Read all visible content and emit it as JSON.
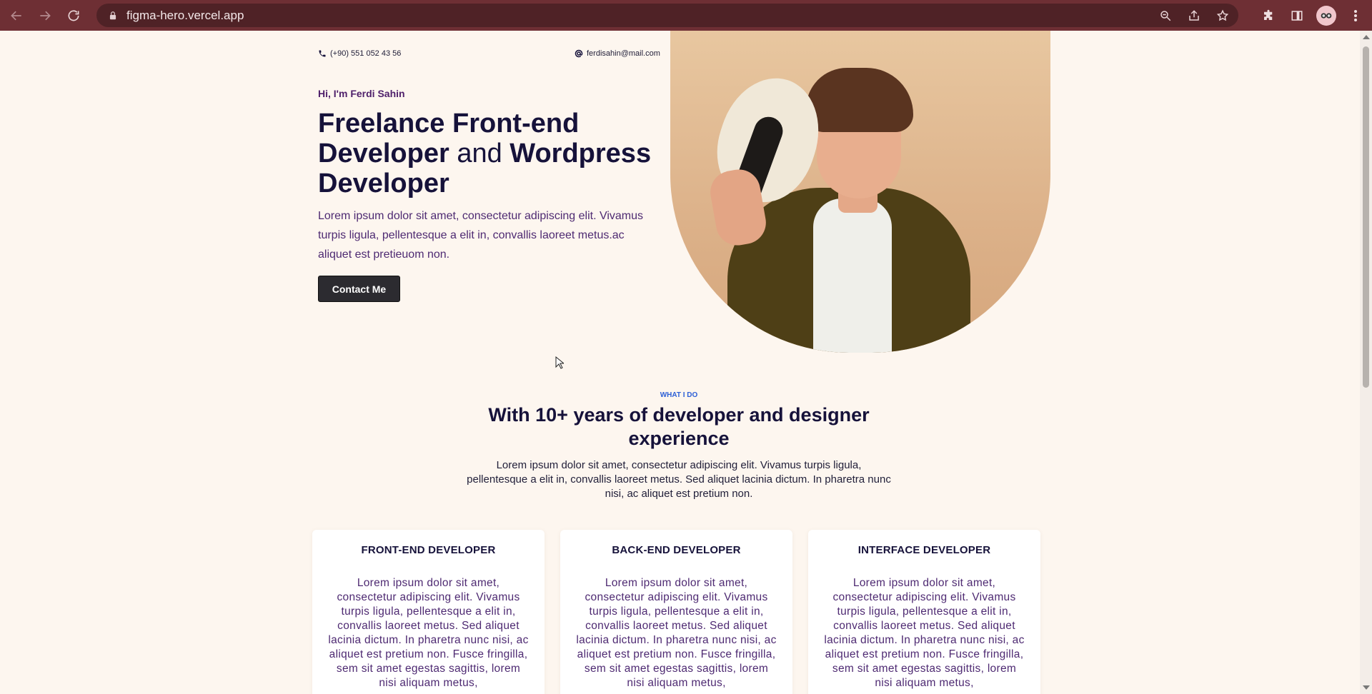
{
  "browser": {
    "url": "figma-hero.vercel.app"
  },
  "hero": {
    "phone": "(+90) 551 052 43 56",
    "email": "ferdisahin@mail.com",
    "greeting": "Hi, I'm Ferdi Sahin",
    "headline_part1": "Freelance Front-end Developer",
    "headline_and": "and",
    "headline_part2": "Wordpress Developer",
    "intro": "Lorem ipsum dolor sit amet, consectetur adipiscing elit. Vivamus turpis ligula, pellentesque a elit in, convallis laoreet metus.ac aliquet est pretieuom non.",
    "cta_label": "Contact Me"
  },
  "services": {
    "eyebrow": "WHAT I DO",
    "title": "With 10+ years of developer and designer experience",
    "description": "Lorem ipsum dolor sit amet, consectetur adipiscing elit. Vivamus turpis ligula, pellentesque a elit in, convallis laoreet metus. Sed aliquet lacinia dictum. In pharetra nunc nisi, ac aliquet est pretium non.",
    "cards": [
      {
        "title": "FRONT-END DEVELOPER",
        "body": "Lorem ipsum dolor sit amet, consectetur adipiscing elit. Vivamus turpis ligula, pellentesque a elit in, convallis laoreet metus. Sed aliquet lacinia dictum. In pharetra nunc nisi, ac aliquet est pretium non. Fusce fringilla, sem sit amet egestas sagittis, lorem nisi aliquam metus,"
      },
      {
        "title": "BACK-END DEVELOPER",
        "body": "Lorem ipsum dolor sit amet, consectetur adipiscing elit. Vivamus turpis ligula, pellentesque a elit in, convallis laoreet metus. Sed aliquet lacinia dictum. In pharetra nunc nisi, ac aliquet est pretium non. Fusce fringilla, sem sit amet egestas sagittis, lorem nisi aliquam metus,"
      },
      {
        "title": "INTERFACE DEVELOPER",
        "body": "Lorem ipsum dolor sit amet, consectetur adipiscing elit. Vivamus turpis ligula, pellentesque a elit in, convallis laoreet metus. Sed aliquet lacinia dictum. In pharetra nunc nisi, ac aliquet est pretium non. Fusce fringilla, sem sit amet egestas sagittis, lorem nisi aliquam metus,"
      }
    ]
  },
  "colors": {
    "chrome": "#6e2f34",
    "page_bg": "#fdf6ef",
    "heading": "#16123a",
    "accent_purple": "#4e2a72",
    "eyebrow_blue": "#2d5fd6",
    "button_bg": "#2c2b30"
  },
  "icons": [
    "back-arrow-icon",
    "forward-arrow-icon",
    "reload-icon",
    "lock-icon",
    "zoom-icon",
    "share-icon",
    "star-icon",
    "puzzle-icon",
    "sidebar-icon",
    "profile-avatar",
    "menu-dots-icon",
    "phone-icon",
    "at-icon",
    "cursor-icon"
  ]
}
